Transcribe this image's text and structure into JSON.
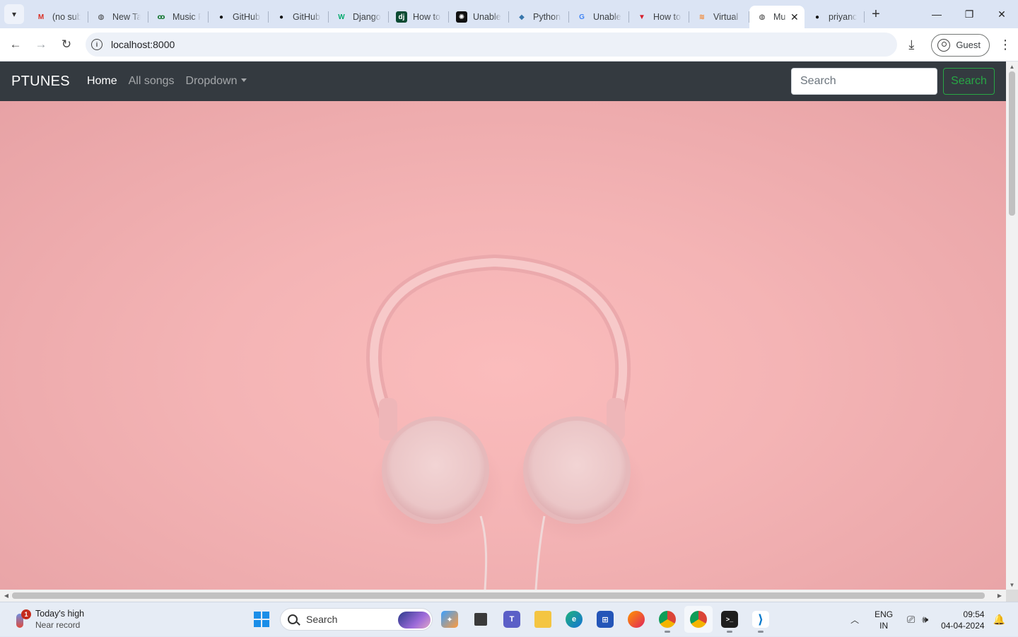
{
  "browser": {
    "tabs": [
      {
        "title": "(no subject)",
        "icon": "gmail-icon",
        "glyph": "M",
        "color": "#d93025",
        "bg": "transparent"
      },
      {
        "title": "New Tab",
        "icon": "globe-icon",
        "glyph": "◍",
        "color": "#333333",
        "bg": "transparent"
      },
      {
        "title": "Music Player",
        "icon": "music-site-icon",
        "glyph": "ꝏ",
        "color": "#1e7c3a",
        "bg": "transparent"
      },
      {
        "title": "GitHub",
        "icon": "github-icon",
        "glyph": "●",
        "color": "#111111",
        "bg": "transparent"
      },
      {
        "title": "GitHub",
        "icon": "github-icon",
        "glyph": "●",
        "color": "#111111",
        "bg": "transparent"
      },
      {
        "title": "Django",
        "icon": "w3schools-icon",
        "glyph": "W",
        "color": "#04aa6d",
        "bg": "transparent"
      },
      {
        "title": "How to",
        "icon": "django-icon",
        "glyph": "dj",
        "color": "#ffffff",
        "bg": "#0c4b33"
      },
      {
        "title": "Unable",
        "icon": "openai-icon",
        "glyph": "✺",
        "color": "#ffffff",
        "bg": "#111111"
      },
      {
        "title": "Python",
        "icon": "python-icon",
        "glyph": "◆",
        "color": "#3776ab",
        "bg": "transparent"
      },
      {
        "title": "Unable",
        "icon": "google-icon",
        "glyph": "G",
        "color": "#4285f4",
        "bg": "transparent"
      },
      {
        "title": "How to",
        "icon": "vercel-icon",
        "glyph": "▼",
        "color": "#d61f2c",
        "bg": "transparent"
      },
      {
        "title": "Virtual",
        "icon": "stackoverflow-icon",
        "glyph": "≋",
        "color": "#f48024",
        "bg": "transparent"
      },
      {
        "title": "Mu",
        "icon": "globe-icon",
        "glyph": "◍",
        "color": "#333333",
        "bg": "transparent",
        "active": true
      },
      {
        "title": "priyanc",
        "icon": "github-icon",
        "glyph": "●",
        "color": "#111111",
        "bg": "transparent"
      }
    ],
    "url": "localhost:8000",
    "profile_label": "Guest"
  },
  "site": {
    "brand": "PTUNES",
    "nav": {
      "home": "Home",
      "all_songs": "All songs",
      "dropdown": "Dropdown"
    },
    "search_placeholder": "Search",
    "search_button": "Search"
  },
  "taskbar": {
    "weather_title": "Today's high",
    "weather_sub": "Near record",
    "weather_badge": "1",
    "search_placeholder": "Search",
    "lang_line1": "ENG",
    "lang_line2": "IN",
    "time": "09:54",
    "date": "04-04-2024"
  },
  "colors": {
    "navbar_bg": "#343a40",
    "search_green": "#28a745",
    "hero_pink": "#f4b4b5"
  }
}
